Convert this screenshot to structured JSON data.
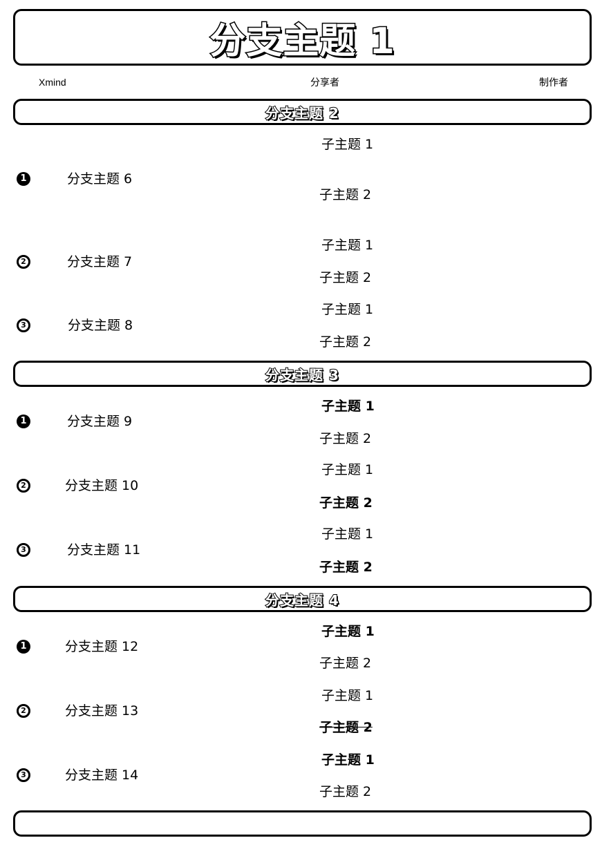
{
  "header": {
    "title": "分支主题 1",
    "meta_left": "Xmind",
    "meta_center": "分享者",
    "meta_right": "制作者"
  },
  "sections": [
    {
      "title": "分支主题 2",
      "branches": [
        {
          "num": "1",
          "label": "分支主题 6",
          "subs": [
            {
              "text": "子主题 1",
              "style": "normal"
            },
            {
              "text": "子主题 2",
              "style": "normal"
            }
          ]
        },
        {
          "num": "2",
          "label": "分支主题 7",
          "subs": [
            {
              "text": "子主题 1",
              "style": "normal"
            },
            {
              "text": "子主题 2",
              "style": "normal"
            }
          ]
        },
        {
          "num": "3",
          "label": "分支主题 8",
          "subs": [
            {
              "text": "子主题 1",
              "style": "normal"
            },
            {
              "text": "子主题 2",
              "style": "normal"
            }
          ]
        }
      ]
    },
    {
      "title": "分支主题 3",
      "branches": [
        {
          "num": "1",
          "label": "分支主题 9",
          "subs": [
            {
              "text": "子主题 1",
              "style": "bold"
            },
            {
              "text": "子主题 2",
              "style": "normal"
            }
          ]
        },
        {
          "num": "2",
          "label": "分支主题 10",
          "subs": [
            {
              "text": "子主题 1",
              "style": "normal"
            },
            {
              "text": "子主题 2",
              "style": "bold"
            }
          ]
        },
        {
          "num": "3",
          "label": "分支主题 11",
          "subs": [
            {
              "text": "子主题 1",
              "style": "normal"
            },
            {
              "text": "子主题 2",
              "style": "bold"
            }
          ]
        }
      ]
    },
    {
      "title": "分支主题 4",
      "branches": [
        {
          "num": "1",
          "label": "分支主题 12",
          "subs": [
            {
              "text": "子主题 1",
              "style": "bold"
            },
            {
              "text": "子主题 2",
              "style": "normal"
            }
          ]
        },
        {
          "num": "2",
          "label": "分支主题 13",
          "subs": [
            {
              "text": "子主题 1",
              "style": "normal"
            },
            {
              "text": "子主题 2",
              "style": "strike"
            }
          ]
        },
        {
          "num": "3",
          "label": "分支主题 14",
          "subs": [
            {
              "text": "子主题 1",
              "style": "bold"
            },
            {
              "text": "子主题 2",
              "style": "normal"
            }
          ]
        }
      ]
    }
  ],
  "footer_box": ""
}
